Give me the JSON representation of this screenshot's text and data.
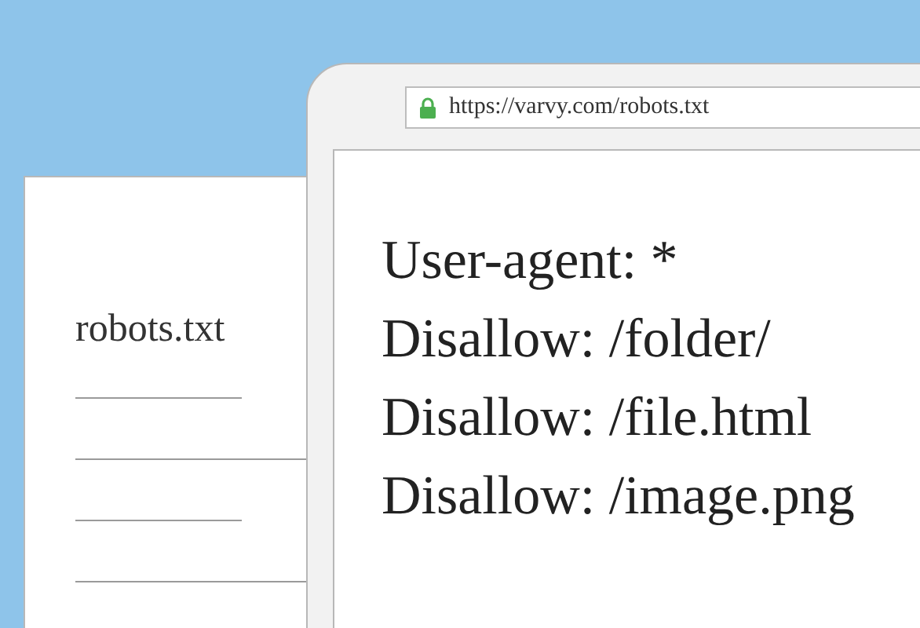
{
  "document": {
    "filename": "robots.txt"
  },
  "address_bar": {
    "url": "https://varvy.com/robots.txt"
  },
  "page": {
    "lines": [
      "User-agent: *",
      "Disallow: /folder/",
      "Disallow: /file.html",
      "Disallow: /image.png"
    ]
  }
}
